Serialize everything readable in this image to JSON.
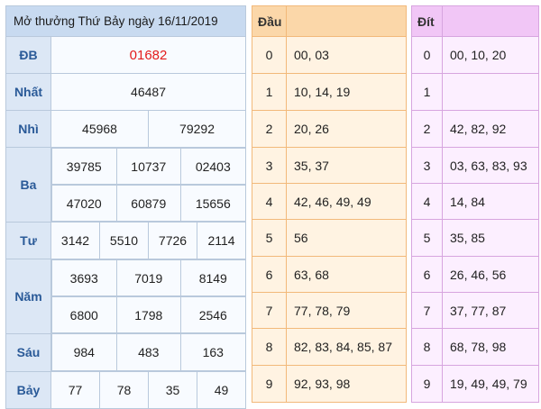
{
  "results": {
    "title": "Mở thưởng Thứ Bảy ngày 16/11/2019",
    "db_label": "ĐB",
    "db": "01682",
    "nhat_label": "Nhất",
    "nhat": "46487",
    "nhi_label": "Nhì",
    "nhi": [
      "45968",
      "79292"
    ],
    "ba_label": "Ba",
    "ba": [
      "39785",
      "10737",
      "02403",
      "47020",
      "60879",
      "15656"
    ],
    "tu_label": "Tư",
    "tu": [
      "3142",
      "5510",
      "7726",
      "2114"
    ],
    "nam_label": "Năm",
    "nam": [
      "3693",
      "7019",
      "8149",
      "6800",
      "1798",
      "2546"
    ],
    "sau_label": "Sáu",
    "sau": [
      "984",
      "483",
      "163"
    ],
    "bay_label": "Bảy",
    "bay": [
      "77",
      "78",
      "35",
      "49"
    ]
  },
  "dau": {
    "header": "Đầu",
    "rows": [
      {
        "digit": "0",
        "values": "00, 03"
      },
      {
        "digit": "1",
        "values": "10, 14, 19"
      },
      {
        "digit": "2",
        "values": "20, 26"
      },
      {
        "digit": "3",
        "values": "35, 37"
      },
      {
        "digit": "4",
        "values": "42, 46, 49, 49"
      },
      {
        "digit": "5",
        "values": "56"
      },
      {
        "digit": "6",
        "values": "63, 68"
      },
      {
        "digit": "7",
        "values": "77, 78, 79"
      },
      {
        "digit": "8",
        "values": "82, 83, 84, 85, 87"
      },
      {
        "digit": "9",
        "values": "92, 93, 98"
      }
    ]
  },
  "dit": {
    "header": "Đít",
    "rows": [
      {
        "digit": "0",
        "values": "00, 10, 20"
      },
      {
        "digit": "1",
        "values": ""
      },
      {
        "digit": "2",
        "values": "42, 82, 92"
      },
      {
        "digit": "3",
        "values": "03, 63, 83, 93"
      },
      {
        "digit": "4",
        "values": "14, 84"
      },
      {
        "digit": "5",
        "values": "35, 85"
      },
      {
        "digit": "6",
        "values": "26, 46, 56"
      },
      {
        "digit": "7",
        "values": "37, 77, 87"
      },
      {
        "digit": "8",
        "values": "68, 78, 98"
      },
      {
        "digit": "9",
        "values": "19, 49, 49, 79"
      }
    ]
  },
  "colors": {
    "result_header": "#c8daf0",
    "prize_label": "#2a5a98",
    "special_prize": "#e31b1b",
    "dau_header": "#fbd7a9",
    "dau_cell": "#fff3e2",
    "dit_header": "#f1c6f6",
    "dit_cell": "#fcefff"
  }
}
